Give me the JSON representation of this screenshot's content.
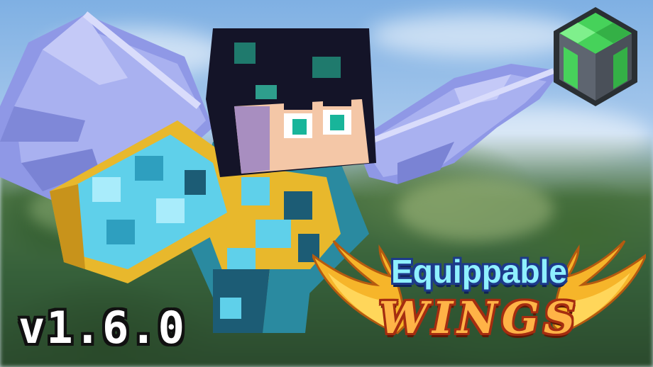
{
  "version_label": "v1.6.0",
  "title": {
    "line1": "Equippable",
    "line2": "WINGS"
  },
  "icons": {
    "logo": "green-grey-cube-logo-icon",
    "character": "minecraft-player-character-icon",
    "wings": "purple-feathered-wings-icon"
  },
  "colors": {
    "sky": "#8fb5dc",
    "wing": "#9aa3ea",
    "armor_gold": "#e8b82c",
    "armor_cyan": "#5fd0ea",
    "title_top": "#8ff0ff",
    "title_bottom": "#ffb347",
    "logo_green": "#46d25a",
    "logo_grey": "#5e6570"
  }
}
